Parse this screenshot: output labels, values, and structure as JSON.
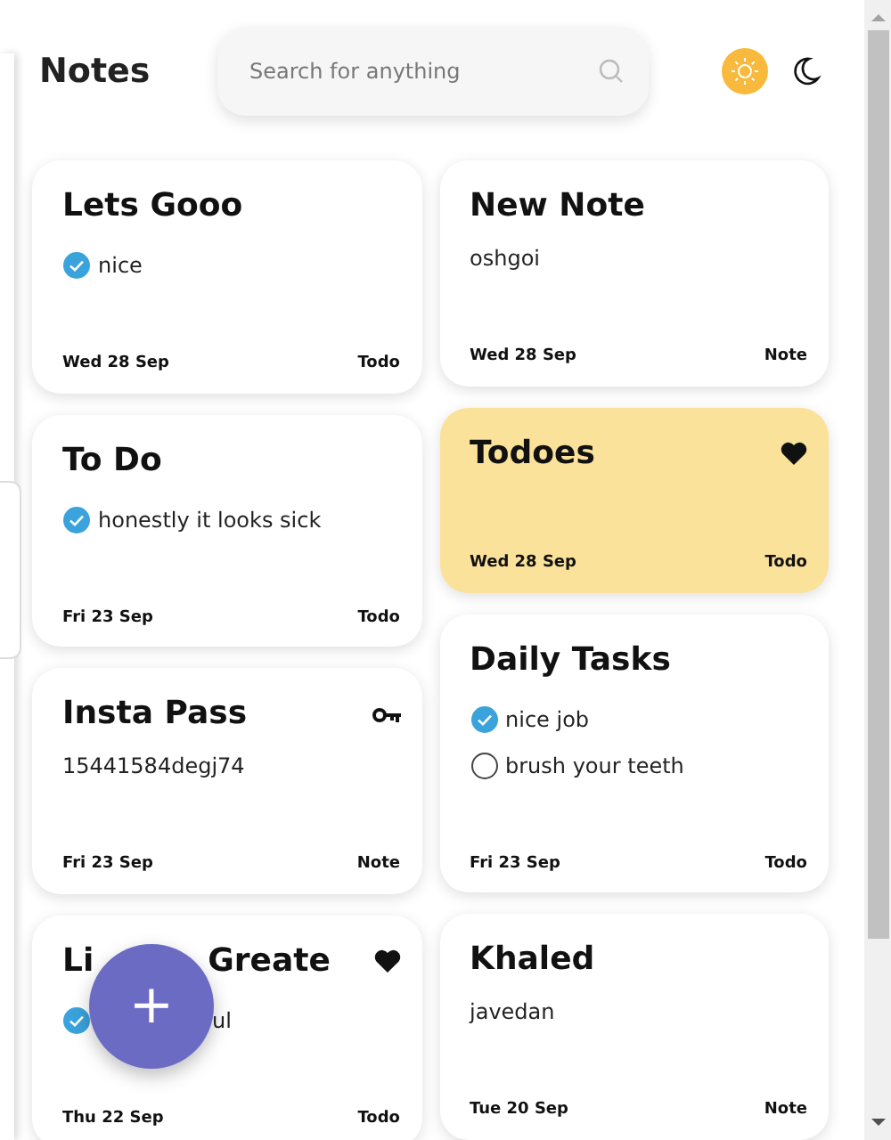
{
  "header": {
    "title": "Notes",
    "search": {
      "placeholder": "Search for anything"
    },
    "theme_buttons": [
      {
        "kind": "sun",
        "selected": true
      },
      {
        "kind": "moon",
        "selected": false
      }
    ]
  },
  "columns": [
    [
      {
        "title": "Lets Gooo",
        "color": "#ffffff",
        "items": [
          {
            "text": "nice",
            "checked": true
          }
        ],
        "date": "Wed 28 Sep",
        "type": "Todo"
      },
      {
        "title": "To Do",
        "color": "#ffffff",
        "items": [
          {
            "text": "honestly it looks sick",
            "checked": true
          }
        ],
        "date": "Fri 23 Sep",
        "type": "Todo"
      },
      {
        "title": "Insta Pass",
        "color": "#ffffff",
        "badge": {
          "kind": "key"
        },
        "body": "15441584degj74",
        "date": "Fri 23 Sep",
        "type": "Note"
      },
      {
        "title_parts": [
          "Li",
          "Greate"
        ],
        "color": "#ffffff",
        "badge": {
          "kind": "heart"
        },
        "items": [
          {
            "text": "ul",
            "checked": true
          }
        ],
        "date": "Thu 22 Sep",
        "type": "Todo"
      }
    ],
    [
      {
        "title": "New Note",
        "color": "#ffffff",
        "body": "oshgoi",
        "date": "Wed 28 Sep",
        "type": "Note"
      },
      {
        "title": "Todoes",
        "color": "#fbe29a",
        "badge": {
          "kind": "heart"
        },
        "date": "Wed 28 Sep",
        "type": "Todo"
      },
      {
        "title": "Daily Tasks",
        "color": "#ffffff",
        "items": [
          {
            "text": "nice job",
            "checked": true
          },
          {
            "text": "brush your teeth",
            "checked": false
          }
        ],
        "date": "Fri 23 Sep",
        "type": "Todo"
      },
      {
        "title": "Khaled",
        "color": "#ffffff",
        "body": "javedan",
        "date": "Tue 20 Sep",
        "type": "Note"
      }
    ]
  ],
  "add_button": {
    "label": "+"
  }
}
